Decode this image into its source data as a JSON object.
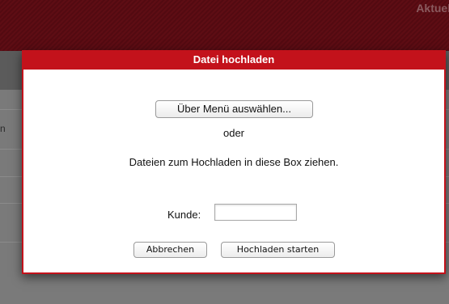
{
  "background": {
    "header_text": "Aktuell",
    "column_fragment": "n"
  },
  "dialog": {
    "title": "Datei hochladen",
    "choose_button": "Über Menü auswählen...",
    "or_text": "oder",
    "drop_text": "Dateien zum Hochladen in diese Box ziehen.",
    "kunde_label": "Kunde:",
    "kunde_value": "",
    "cancel_button": "Abbrechen",
    "upload_button": "Hochladen starten"
  },
  "colors": {
    "dialog_accent": "#c3121b",
    "header_background": "#5e0d14"
  }
}
